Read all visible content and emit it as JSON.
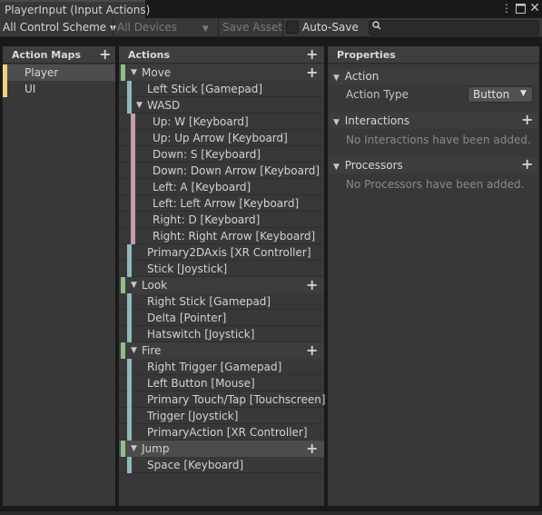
{
  "window": {
    "tab_title": "PlayerInput (Input Actions)",
    "menu_icon": "kebab-menu-icon",
    "maximize_icon": "maximize-icon",
    "close_icon": "close-icon"
  },
  "toolbar": {
    "control_scheme": "All Control Scheme",
    "devices": "All Devices",
    "save_asset": "Save Asset",
    "auto_save": "Auto-Save",
    "auto_save_checked": false,
    "search_value": ""
  },
  "action_maps": {
    "header": "Action Maps",
    "items": [
      {
        "label": "Player",
        "selected": true
      },
      {
        "label": "UI",
        "selected": false
      }
    ]
  },
  "actions": {
    "header": "Actions",
    "rows": [
      {
        "kind": "action",
        "label": "Move",
        "plus": true
      },
      {
        "kind": "binding",
        "label": "Left Stick [Gamepad]"
      },
      {
        "kind": "composite",
        "label": "WASD"
      },
      {
        "kind": "part",
        "label": "Up: W [Keyboard]"
      },
      {
        "kind": "part",
        "label": "Up: Up Arrow [Keyboard]"
      },
      {
        "kind": "part",
        "label": "Down: S [Keyboard]"
      },
      {
        "kind": "part",
        "label": "Down: Down Arrow [Keyboard]"
      },
      {
        "kind": "part",
        "label": "Left: A [Keyboard]"
      },
      {
        "kind": "part",
        "label": "Left: Left Arrow [Keyboard]"
      },
      {
        "kind": "part",
        "label": "Right: D [Keyboard]"
      },
      {
        "kind": "part",
        "label": "Right: Right Arrow [Keyboard]"
      },
      {
        "kind": "binding",
        "label": "Primary2DAxis [XR Controller]"
      },
      {
        "kind": "binding",
        "label": "Stick [Joystick]"
      },
      {
        "kind": "action",
        "label": "Look",
        "plus": true
      },
      {
        "kind": "binding",
        "label": "Right Stick [Gamepad]"
      },
      {
        "kind": "binding",
        "label": "Delta [Pointer]"
      },
      {
        "kind": "binding",
        "label": "Hatswitch [Joystick]"
      },
      {
        "kind": "action",
        "label": "Fire",
        "plus": true
      },
      {
        "kind": "binding",
        "label": "Right Trigger [Gamepad]"
      },
      {
        "kind": "binding",
        "label": "Left Button [Mouse]"
      },
      {
        "kind": "binding",
        "label": "Primary Touch/Tap [Touchscreen]"
      },
      {
        "kind": "binding",
        "label": "Trigger [Joystick]"
      },
      {
        "kind": "binding",
        "label": "PrimaryAction [XR Controller]"
      },
      {
        "kind": "action",
        "label": "Jump",
        "plus": true,
        "selected": true
      },
      {
        "kind": "binding",
        "label": "Space [Keyboard]"
      }
    ]
  },
  "properties": {
    "header": "Properties",
    "action_section": "Action",
    "action_type_label": "Action Type",
    "action_type_value": "Button",
    "interactions_section": "Interactions",
    "interactions_empty": "No Interactions have been added.",
    "processors_section": "Processors",
    "processors_empty": "No Processors have been added."
  },
  "colors": {
    "action_bar": "#8dbf8a",
    "binding_bar": "#8fb8bd",
    "composite_part_bar": "#c59cad",
    "map_bar": "#f0d27e"
  }
}
